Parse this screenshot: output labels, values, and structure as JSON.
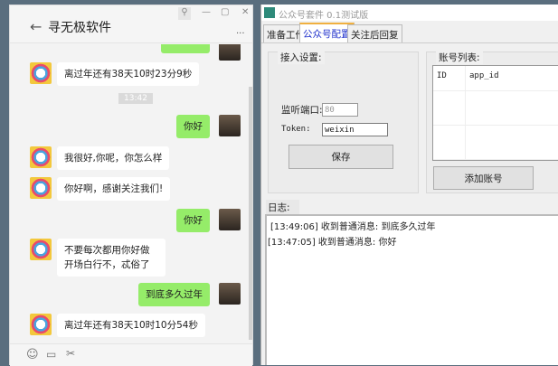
{
  "wechat": {
    "title": "寻无极软件",
    "more": "···",
    "messages": [
      {
        "from": "bot",
        "text": "离过年还有38天10时23分9秒"
      },
      {
        "time": "13:42"
      },
      {
        "from": "me",
        "text": "你好"
      },
      {
        "from": "bot",
        "text": "我很好,你呢，你怎么样"
      },
      {
        "from": "bot",
        "text": "你好啊，感谢关注我们!"
      },
      {
        "from": "me",
        "text": "你好"
      },
      {
        "from": "bot",
        "text": "不要每次都用你好做开场白行不，忒俗了"
      },
      {
        "from": "me",
        "text": "到底多久过年"
      },
      {
        "from": "bot",
        "text": "离过年还有38天10时10分54秒"
      }
    ]
  },
  "app": {
    "title": "公众号套件 0.1测试版",
    "tabs": [
      "准备工作",
      "公众号配置",
      "关注后回复"
    ],
    "access_group": "接入设置:",
    "port_label": "监听端口:",
    "port_value": "80",
    "token_label": "Token:",
    "token_value": "weixin",
    "save": "保存",
    "accounts_group": "账号列表:",
    "columns": [
      "ID",
      "app_id"
    ],
    "add_account": "添加账号",
    "log_label": "日志:",
    "log": [
      "[13:49:06] 收到普通消息: 到底多久过年",
      "[13:47:05] 收到普通消息: 你好"
    ]
  }
}
